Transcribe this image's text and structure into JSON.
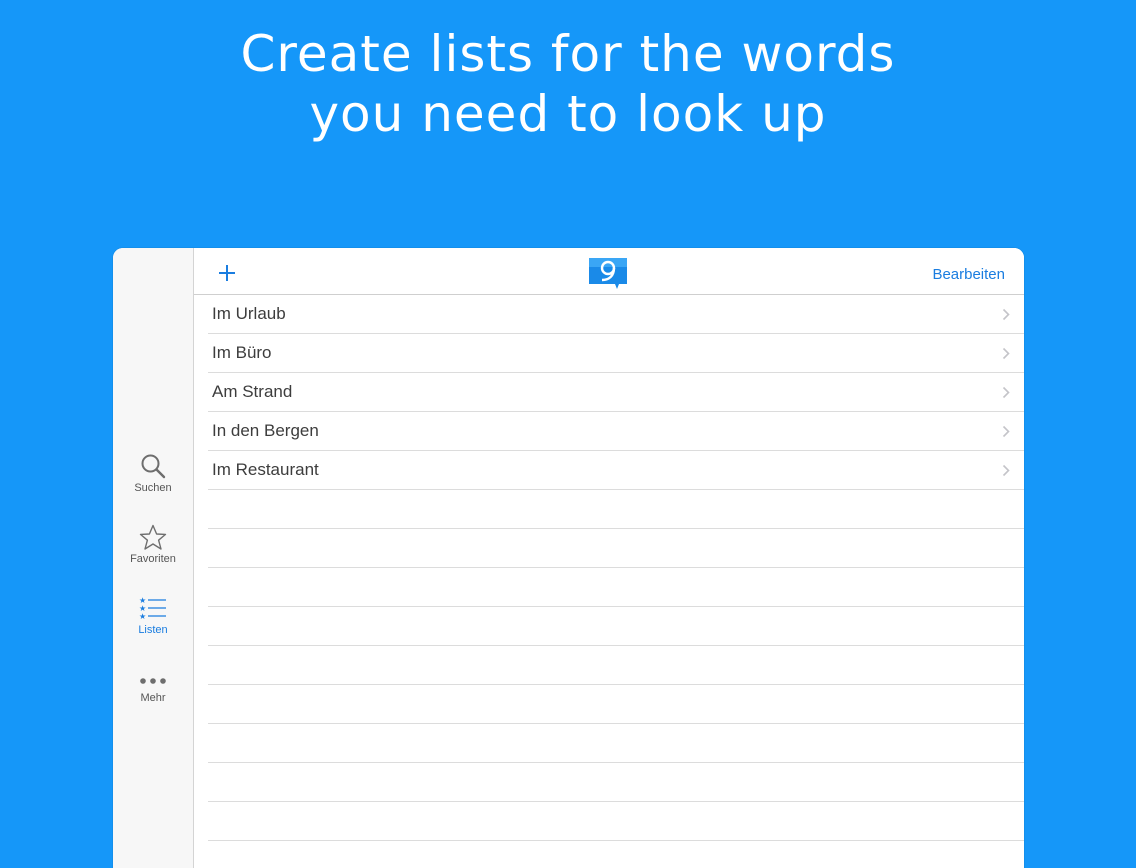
{
  "headline": {
    "line1": "Create lists for the words",
    "line2": "you need to look up"
  },
  "navbar": {
    "add_icon": "plus-icon",
    "logo_icon": "app-logo-icon",
    "edit_label": "Bearbeiten"
  },
  "sidebar": {
    "tabs": [
      {
        "label": "Suchen",
        "icon": "search-icon"
      },
      {
        "label": "Favoriten",
        "icon": "star-icon"
      },
      {
        "label": "Listen",
        "icon": "list-icon",
        "active": true
      },
      {
        "label": "Mehr",
        "icon": "more-icon"
      }
    ]
  },
  "lists": {
    "items": [
      {
        "label": "Im Urlaub"
      },
      {
        "label": "Im Büro"
      },
      {
        "label": "Am Strand"
      },
      {
        "label": "In den Bergen"
      },
      {
        "label": "Im Restaurant"
      }
    ],
    "empty_rows": 9
  },
  "colors": {
    "background": "#1597f9",
    "accent": "#1a7de0"
  }
}
